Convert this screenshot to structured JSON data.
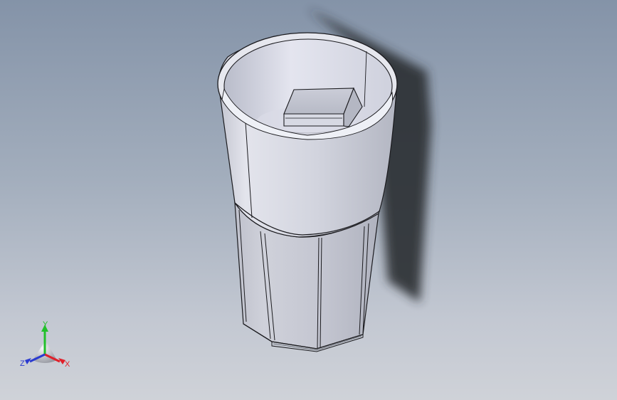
{
  "viewport": {
    "background_top": "#8493a8",
    "background_bottom": "#cfd2d8"
  },
  "part": {
    "color": "#c9cbd8",
    "edge_color": "#1b1b1f",
    "shadow_color": "#2b2d33"
  },
  "triad": {
    "x_label": "X",
    "y_label": "Y",
    "z_label": "Z",
    "x_color": "#e0202a",
    "y_color": "#22c02a",
    "z_color": "#2a3ad0"
  }
}
